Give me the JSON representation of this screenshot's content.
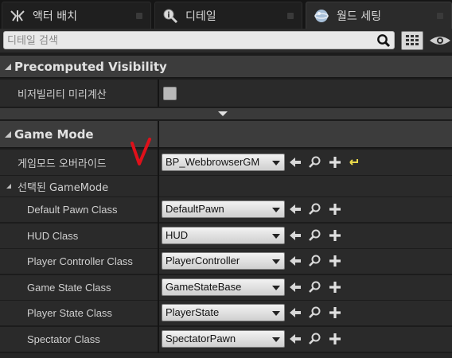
{
  "tabs": [
    {
      "label": "액터 배치",
      "icon": "place-actors-icon",
      "active": false
    },
    {
      "label": "디테일",
      "icon": "details-icon",
      "active": false
    },
    {
      "label": "월드 세팅",
      "icon": "world-settings-icon",
      "active": true
    }
  ],
  "search": {
    "placeholder": "디테일 검색",
    "value": ""
  },
  "sections": {
    "precomputed": {
      "title": "Precomputed Visibility",
      "setting_label": "비저빌리티 미리계산",
      "checked": false
    },
    "game_mode": {
      "title": "Game Mode",
      "override_label": "게임모드 오버라이드",
      "override_value": "BP_WebbrowserGM",
      "selected_label": "선택된 GameMode",
      "classes": [
        {
          "label": "Default Pawn Class",
          "value": "DefaultPawn"
        },
        {
          "label": "HUD Class",
          "value": "HUD"
        },
        {
          "label": "Player Controller Class",
          "value": "PlayerController"
        },
        {
          "label": "Game State Class",
          "value": "GameStateBase"
        },
        {
          "label": "Player State Class",
          "value": "PlayerState"
        },
        {
          "label": "Spectator Class",
          "value": "SpectatorPawn"
        }
      ]
    }
  },
  "colors": {
    "annotation": "#e0101a",
    "accent_yellow": "#e8d84a"
  }
}
